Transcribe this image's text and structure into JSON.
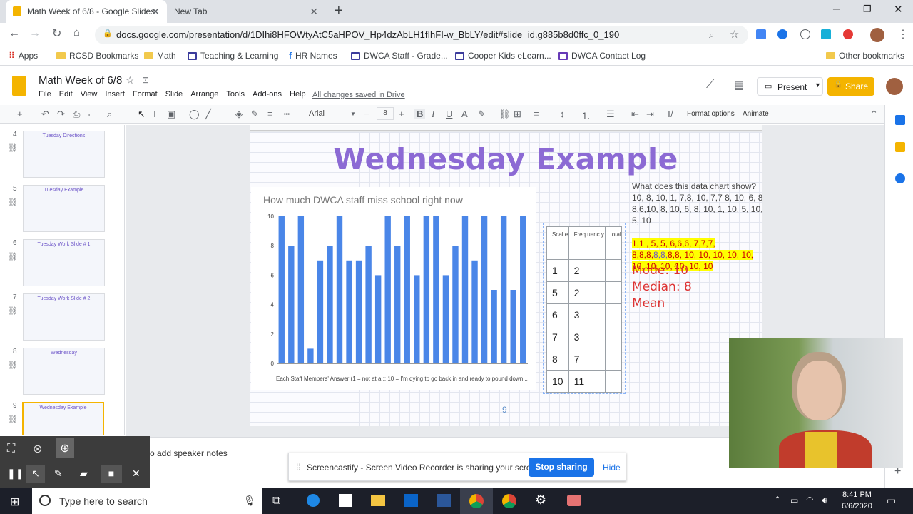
{
  "browser": {
    "tabs": [
      {
        "label": "Math Week of 6/8 - Google Slides",
        "active": true
      },
      {
        "label": "New Tab",
        "active": false
      }
    ],
    "url": "docs.google.com/presentation/d/1DIhi8HFOWtyAtC5aHPOV_Hp4dzAbLH1fIhFI-w_BbLY/edit#slide=id.g885b8d0ffc_0_190",
    "bookmarks": [
      "Apps",
      "RCSD Bookmarks",
      "Math",
      "Teaching & Learning",
      "HR Names",
      "DWCA Staff - Grade...",
      "Cooper Kids eLearn...",
      "DWCA Contact Log"
    ],
    "other_bookmarks": "Other bookmarks"
  },
  "docs": {
    "title": "Math Week of 6/8",
    "menu": [
      "File",
      "Edit",
      "View",
      "Insert",
      "Format",
      "Slide",
      "Arrange",
      "Tools",
      "Add-ons",
      "Help"
    ],
    "saved_status": "All changes saved in Drive",
    "present_label": "Present",
    "share_label": "Share",
    "font_name": "Arial",
    "font_size": "8",
    "format_options": "Format options",
    "animate": "Animate",
    "speaker_notes_placeholder": "o add speaker notes"
  },
  "filmstrip": [
    {
      "num": "4",
      "title": "Tuesday Directions"
    },
    {
      "num": "5",
      "title": "Tuesday Example"
    },
    {
      "num": "6",
      "title": "Tuesday Work Slide # 1"
    },
    {
      "num": "7",
      "title": "Tuesday Work Slide # 2"
    },
    {
      "num": "8",
      "title": "Wednesday"
    },
    {
      "num": "9",
      "title": "Wednesday Example"
    }
  ],
  "slide": {
    "title": "Wednesday Example",
    "question": "What does this data chart show?",
    "raw_data": "10, 8, 10, 1, 7,8, 10, 7,7 8, 10, 6, 8, 8,6,10, 8, 10, 6, 8, 10, 1, 10, 5, 10, 5, 10",
    "sorted_red": "1,1 , 5, 5, 6,6,6, 7,7,7, 8,8,8,",
    "sorted_purple": "8,8,",
    "sorted_red2": "8,8, 10, 10, 10, 10, 10, 10, 10, 10, 10, 10, 10",
    "mode": "Mode: 10",
    "median": "Median: 8",
    "mean": "Mean",
    "page_number": "9",
    "table": {
      "headers": [
        "Scal e",
        "Freq uenc y",
        "total"
      ],
      "rows": [
        [
          "1",
          "2",
          ""
        ],
        [
          "5",
          "2",
          ""
        ],
        [
          "6",
          "3",
          ""
        ],
        [
          "7",
          "3",
          ""
        ],
        [
          "8",
          "7",
          ""
        ],
        [
          "10",
          "11",
          ""
        ]
      ]
    }
  },
  "chart_data": {
    "type": "bar",
    "title": "How much DWCA staff miss school right now",
    "xlabel": "Each Staff Members' Answer (1 = not at a;;; 10 = I'm dying to go back in and ready to pound down...",
    "ylabel": "",
    "ylim": [
      0,
      10
    ],
    "yticks": [
      0,
      2,
      4,
      6,
      8,
      10
    ],
    "values": [
      10,
      8,
      10,
      1,
      7,
      8,
      10,
      7,
      7,
      8,
      6,
      10,
      8,
      10,
      6,
      10,
      10,
      6,
      8,
      10,
      7,
      10,
      5,
      10,
      5,
      10
    ],
    "color": "#4a86e8"
  },
  "screencast": {
    "message": "Screencastify - Screen Video Recorder is sharing your screen.",
    "stop": "Stop sharing",
    "hide": "Hide"
  },
  "taskbar": {
    "search_placeholder": "Type here to search",
    "time": "8:41 PM",
    "date": "6/6/2020"
  }
}
